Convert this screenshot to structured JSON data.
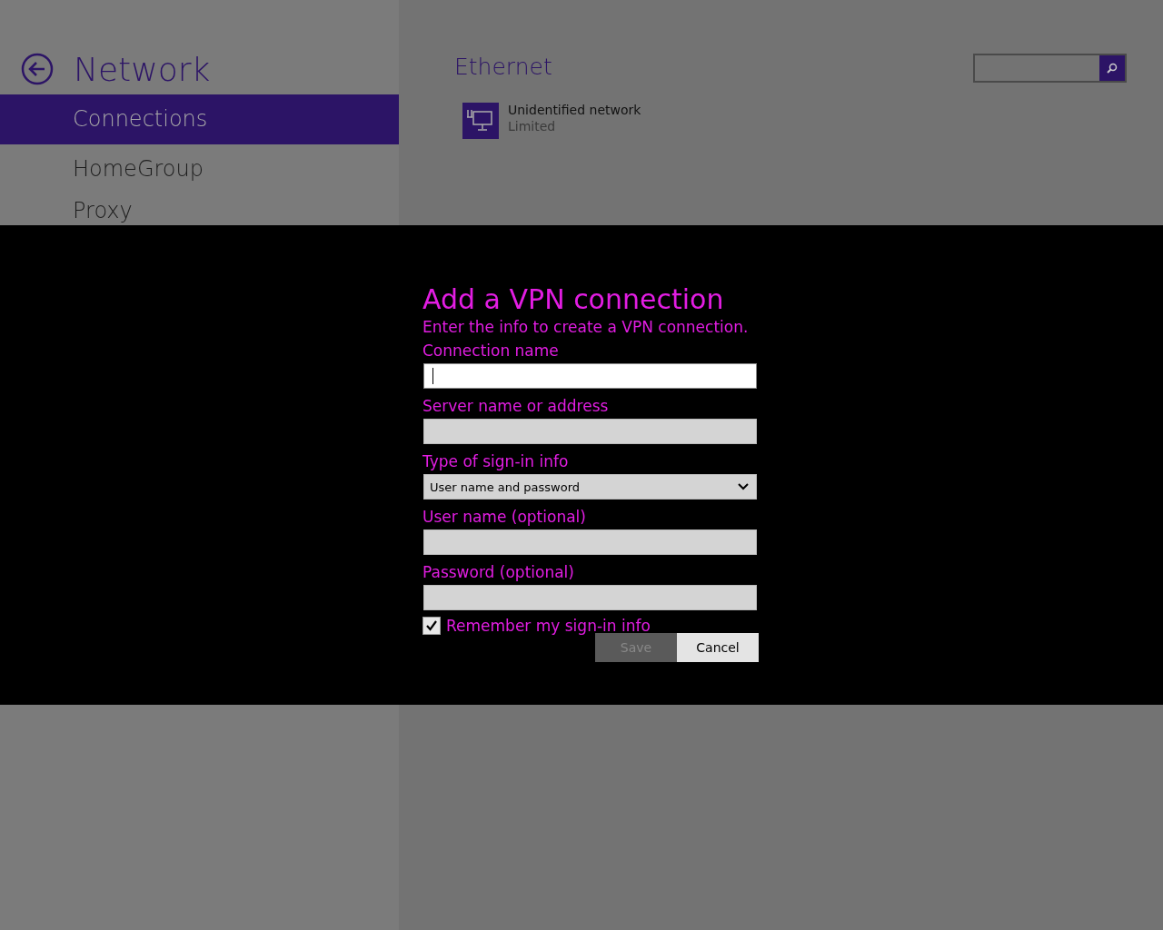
{
  "sidebar": {
    "title": "Network",
    "items": [
      {
        "label": "Connections",
        "selected": true
      },
      {
        "label": "HomeGroup",
        "selected": false
      },
      {
        "label": "Proxy",
        "selected": false
      }
    ]
  },
  "content": {
    "heading": "Ethernet",
    "network": {
      "name": "Unidentified network",
      "status": "Limited"
    }
  },
  "dialog": {
    "title": "Add a VPN connection",
    "subtitle": "Enter the info to create a VPN connection.",
    "fields": [
      {
        "kind": "text",
        "label": "Connection name",
        "focused": true
      },
      {
        "kind": "text",
        "label": "Server name or address",
        "focused": false
      },
      {
        "kind": "select",
        "label": "Type of sign-in info",
        "value": "User name and password",
        "focused": false
      },
      {
        "kind": "text",
        "label": "User name (optional)",
        "focused": false
      },
      {
        "kind": "text",
        "label": "Password (optional)",
        "focused": false
      }
    ],
    "remember": {
      "label": "Remember my sign-in info",
      "checked": true
    },
    "buttons": [
      {
        "label": "Save",
        "disabled": true
      },
      {
        "label": "Cancel",
        "disabled": false
      }
    ]
  }
}
